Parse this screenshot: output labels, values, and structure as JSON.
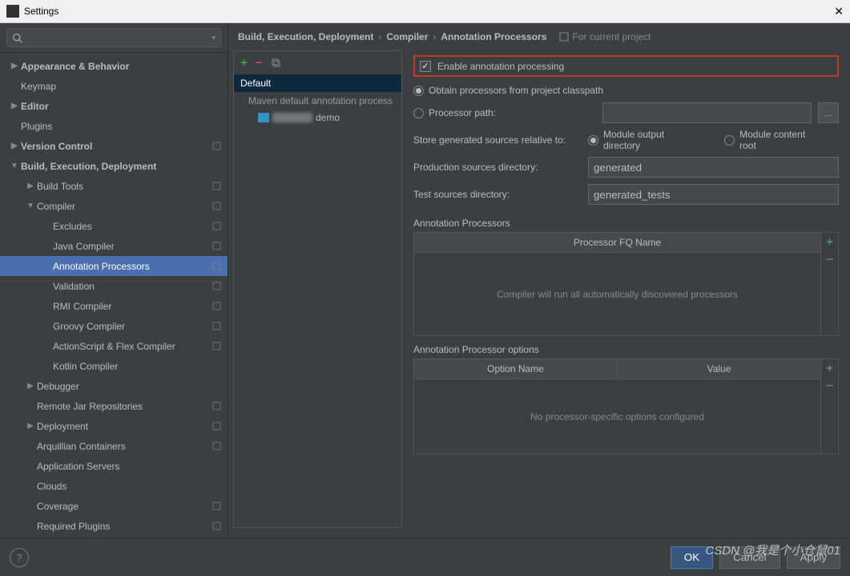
{
  "window": {
    "title": "Settings",
    "close": "✕"
  },
  "search": {
    "placeholder": ""
  },
  "sidebar": {
    "items": [
      {
        "label": "Appearance & Behavior",
        "lvl": 0,
        "arrow": "▶",
        "bold": true
      },
      {
        "label": "Keymap",
        "lvl": 0,
        "arrow": ""
      },
      {
        "label": "Editor",
        "lvl": 0,
        "arrow": "▶",
        "bold": true
      },
      {
        "label": "Plugins",
        "lvl": 0,
        "arrow": ""
      },
      {
        "label": "Version Control",
        "lvl": 0,
        "arrow": "▶",
        "bold": true,
        "cfg": true
      },
      {
        "label": "Build, Execution, Deployment",
        "lvl": 0,
        "arrow": "▼",
        "bold": true
      },
      {
        "label": "Build Tools",
        "lvl": 1,
        "arrow": "▶",
        "cfg": true
      },
      {
        "label": "Compiler",
        "lvl": 1,
        "arrow": "▼",
        "cfg": true
      },
      {
        "label": "Excludes",
        "lvl": 2,
        "arrow": "",
        "cfg": true
      },
      {
        "label": "Java Compiler",
        "lvl": 2,
        "arrow": "",
        "cfg": true
      },
      {
        "label": "Annotation Processors",
        "lvl": 2,
        "arrow": "",
        "cfg": true,
        "selected": true
      },
      {
        "label": "Validation",
        "lvl": 2,
        "arrow": "",
        "cfg": true
      },
      {
        "label": "RMI Compiler",
        "lvl": 2,
        "arrow": "",
        "cfg": true
      },
      {
        "label": "Groovy Compiler",
        "lvl": 2,
        "arrow": "",
        "cfg": true
      },
      {
        "label": "ActionScript & Flex Compiler",
        "lvl": 2,
        "arrow": "",
        "cfg": true
      },
      {
        "label": "Kotlin Compiler",
        "lvl": 2,
        "arrow": ""
      },
      {
        "label": "Debugger",
        "lvl": 1,
        "arrow": "▶"
      },
      {
        "label": "Remote Jar Repositories",
        "lvl": 1,
        "arrow": "",
        "cfg": true
      },
      {
        "label": "Deployment",
        "lvl": 1,
        "arrow": "▶",
        "cfg": true
      },
      {
        "label": "Arquillian Containers",
        "lvl": 1,
        "arrow": "",
        "cfg": true
      },
      {
        "label": "Application Servers",
        "lvl": 1,
        "arrow": ""
      },
      {
        "label": "Clouds",
        "lvl": 1,
        "arrow": ""
      },
      {
        "label": "Coverage",
        "lvl": 1,
        "arrow": "",
        "cfg": true
      },
      {
        "label": "Required Plugins",
        "lvl": 1,
        "arrow": "",
        "cfg": true
      }
    ]
  },
  "breadcrumb": {
    "c1": "Build, Execution, Deployment",
    "c2": "Compiler",
    "c3": "Annotation Processors",
    "scope": "For current project"
  },
  "profiles": {
    "default": "Default",
    "maven": "Maven default annotation process",
    "module": "demo"
  },
  "form": {
    "enable": "Enable annotation processing",
    "obtainClasspath": "Obtain processors from project classpath",
    "procPathLabel": "Processor path:",
    "procPathValue": "",
    "storeLabel": "Store generated sources relative to:",
    "storeOpt1": "Module output directory",
    "storeOpt2": "Module content root",
    "prodDirLabel": "Production sources directory:",
    "prodDirValue": "generated",
    "testDirLabel": "Test sources directory:",
    "testDirValue": "generated_tests",
    "tbl1Title": "Annotation Processors",
    "tbl1Col": "Processor FQ Name",
    "tbl1Empty": "Compiler will run all automatically discovered processors",
    "tbl2Title": "Annotation Processor options",
    "tbl2Col1": "Option Name",
    "tbl2Col2": "Value",
    "tbl2Empty": "No processor-specific options configured"
  },
  "footer": {
    "ok": "OK",
    "cancel": "Cancel",
    "apply": "Apply"
  },
  "watermark": "CSDN @我是个小仓鼠01"
}
